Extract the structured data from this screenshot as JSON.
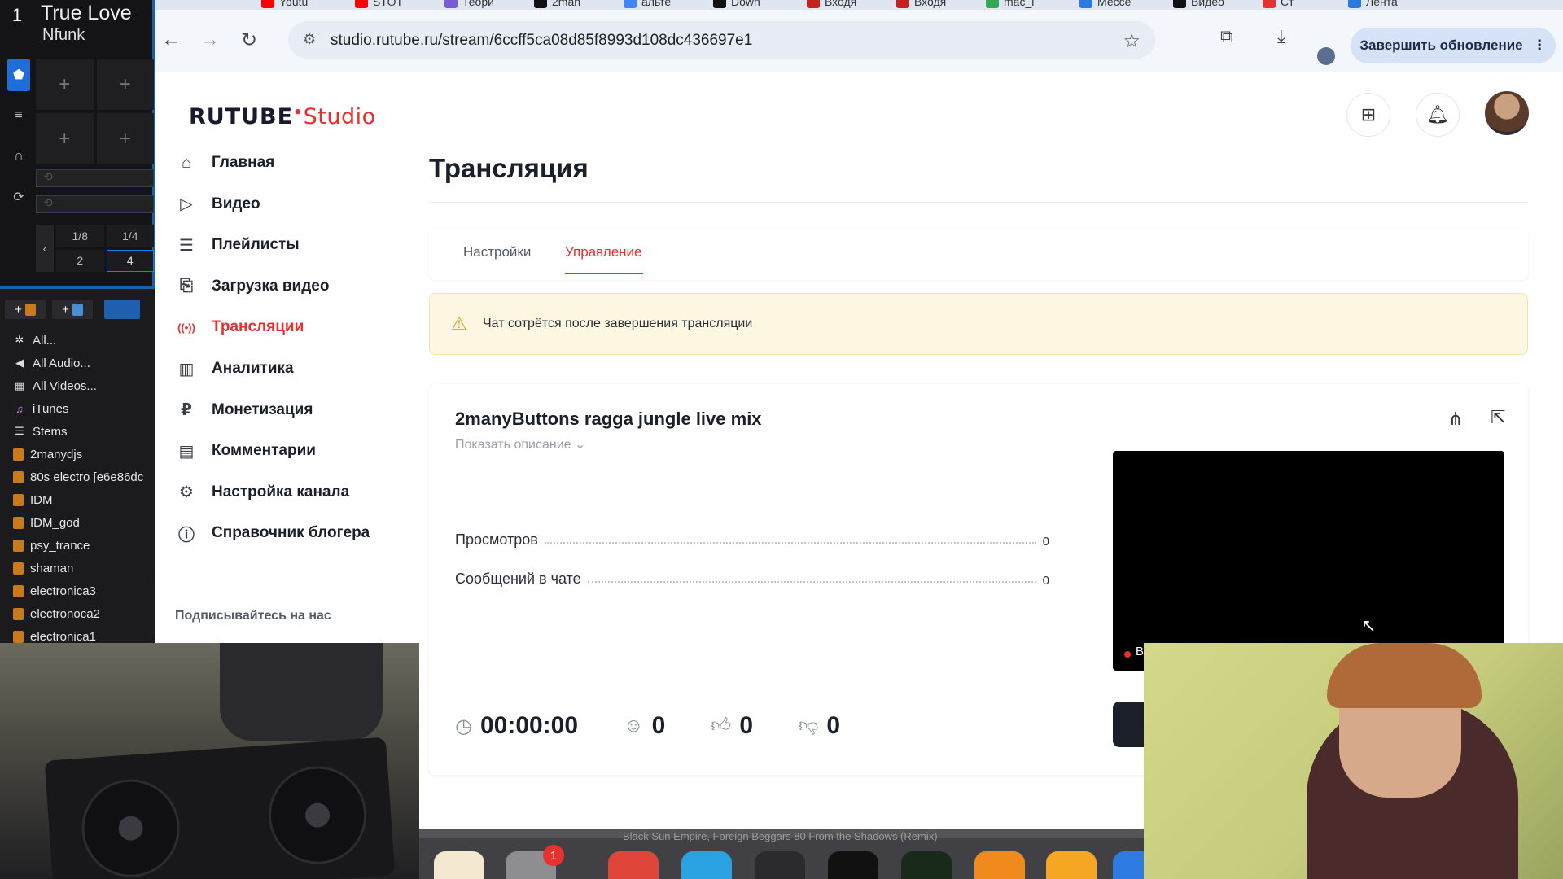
{
  "dj": {
    "deck_number": "1",
    "track_title": "True Love",
    "track_artist": "Nfunk",
    "pad_plus": "+",
    "beats": [
      "1/8",
      "1/4",
      "2",
      "4"
    ],
    "beat_arrow": "‹",
    "tool_plus": "+",
    "library": [
      {
        "label": "All...",
        "icon": "gear-icon"
      },
      {
        "label": "All Audio...",
        "icon": "speaker-icon"
      },
      {
        "label": "All Videos...",
        "icon": "film-icon"
      },
      {
        "label": "iTunes",
        "icon": "itunes-icon"
      },
      {
        "label": "Stems",
        "icon": "stems-icon"
      },
      {
        "label": "2manydjs",
        "icon": "crate-icon"
      },
      {
        "label": "80s electro [e6e86dc",
        "icon": "crate-icon"
      },
      {
        "label": "IDM",
        "icon": "crate-icon"
      },
      {
        "label": "IDM_god",
        "icon": "crate-icon"
      },
      {
        "label": "psy_trance",
        "icon": "crate-icon"
      },
      {
        "label": "shaman",
        "icon": "crate-icon"
      },
      {
        "label": "electronica3",
        "icon": "crate-icon"
      },
      {
        "label": "electronoca2",
        "icon": "crate-icon"
      },
      {
        "label": "electronica1",
        "icon": "crate-icon"
      }
    ]
  },
  "browser": {
    "tabs": [
      {
        "label": "Youtu",
        "color": "#ff0000"
      },
      {
        "label": "STOT",
        "color": "#ff0000"
      },
      {
        "label": "Теори",
        "color": "#7a5cd6"
      },
      {
        "label": "2man",
        "color": "#111111"
      },
      {
        "label": "альте",
        "color": "#4285f4"
      },
      {
        "label": "Down",
        "color": "#111111"
      },
      {
        "label": "Входя",
        "color": "#c5221f"
      },
      {
        "label": "Входя",
        "color": "#c5221f"
      },
      {
        "label": "mac_i",
        "color": "#34a853"
      },
      {
        "label": "Мессе",
        "color": "#2a7be0"
      },
      {
        "label": "Видео",
        "color": "#111111"
      },
      {
        "label": "Ст",
        "color": "#e8312f"
      },
      {
        "label": "Лента",
        "color": "#2a7be0"
      }
    ],
    "url": "studio.rutube.ru/stream/6ccff5ca08d85f8993d108dc436697e1",
    "update_button": "Завершить обновление",
    "back": "←",
    "forward": "→",
    "reload": "↻",
    "star": "☆",
    "extensions": "⧉",
    "download": "⤓",
    "menu": "⋮"
  },
  "studio": {
    "logo_main": "RUTUBE",
    "logo_studio": "Studio",
    "nav": [
      {
        "label": "Главная",
        "icon": "home-icon",
        "glyph": "⌂",
        "active": false
      },
      {
        "label": "Видео",
        "icon": "video-icon",
        "glyph": "▷",
        "active": false
      },
      {
        "label": "Плейлисты",
        "icon": "playlist-icon",
        "glyph": "☰",
        "active": false
      },
      {
        "label": "Загрузка видео",
        "icon": "upload-icon",
        "glyph": "⎘",
        "active": false
      },
      {
        "label": "Трансляции",
        "icon": "broadcast-icon",
        "glyph": "((•))",
        "active": true
      },
      {
        "label": "Аналитика",
        "icon": "analytics-icon",
        "glyph": "▥",
        "active": false
      },
      {
        "label": "Монетизация",
        "icon": "ruble-icon",
        "glyph": "₽",
        "active": false
      },
      {
        "label": "Комментарии",
        "icon": "comments-icon",
        "glyph": "▤",
        "active": false
      },
      {
        "label": "Настройка канала",
        "icon": "settings-icon",
        "glyph": "⚙",
        "active": false
      },
      {
        "label": "Справочник блогера",
        "icon": "info-icon",
        "glyph": "ⓘ",
        "active": false
      }
    ],
    "follow_label": "Подписывайтесь на нас",
    "page_title": "Трансляция",
    "tabs": [
      {
        "label": "Настройки",
        "active": false
      },
      {
        "label": "Управление",
        "active": true
      }
    ],
    "alert_text": "Чат сотрётся после завершения трансляции",
    "stream": {
      "name": "2manyButtons ragga jungle live mix",
      "show_description": "Показать описание ⌄",
      "stats": [
        {
          "label": "Просмотров",
          "value": "0"
        },
        {
          "label": "Сообщений в чате",
          "value": "0"
        }
      ],
      "live_label": "В",
      "timer": "00:00:00",
      "viewers": "0",
      "likes": "0",
      "dislikes": "0"
    }
  },
  "dock": {
    "now_playing": "Black Sun Empire, Foreign Beggars         80         From the Shadows (Remix)",
    "badge": "1"
  }
}
